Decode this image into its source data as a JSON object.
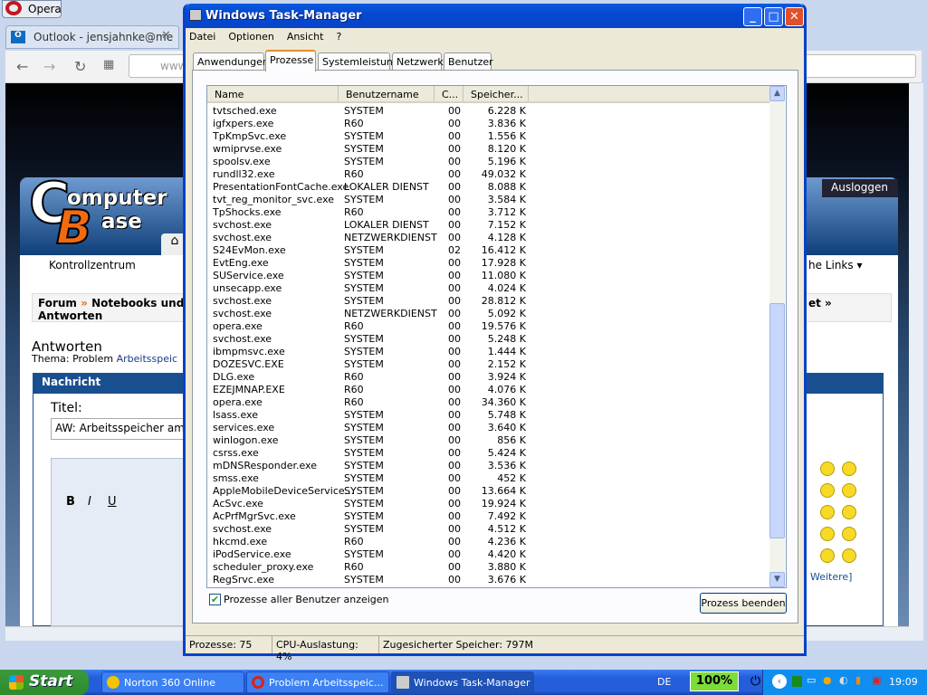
{
  "browser": {
    "app_label": "Opera",
    "tab_title": "Outlook - jensjahnke@me",
    "address": "www",
    "site": {
      "logo_text": "ComputerBase",
      "logo_c": "C",
      "logo_line1": "omputer",
      "logo_b": "B",
      "logo_line2": "ase",
      "nav_item": "Kontrollzentrum",
      "breadcrumb_forum": "Forum",
      "breadcrumb_sep": "»",
      "breadcrumb_section": "Notebooks und",
      "breadcrumb_line2": "Antworten",
      "page_heading": "Antworten",
      "thema_label": "Thema: Problem",
      "thema_link": "Arbeitsspeic",
      "nachricht_header": "Nachricht",
      "titel_label": "Titel:",
      "titel_value": "AW: Arbeitsspeicher am",
      "logout": "Ausloggen",
      "links_menu": "he Links ▾",
      "breadcrumb_right": "et »",
      "weitere": "Weitere]"
    }
  },
  "taskmanager": {
    "title": "Windows Task-Manager",
    "menu": [
      "Datei",
      "Optionen",
      "Ansicht",
      "?"
    ],
    "tabs": [
      "Anwendungen",
      "Prozesse",
      "Systemleistung",
      "Netzwerk",
      "Benutzer"
    ],
    "active_tab": "Prozesse",
    "columns": [
      "Name",
      "Benutzername",
      "C...",
      "Speicher..."
    ],
    "processes": [
      [
        "tvtsched.exe",
        "SYSTEM",
        "00",
        "6.228 K"
      ],
      [
        "igfxpers.exe",
        "R60",
        "00",
        "3.836 K"
      ],
      [
        "TpKmpSvc.exe",
        "SYSTEM",
        "00",
        "1.556 K"
      ],
      [
        "wmiprvse.exe",
        "SYSTEM",
        "00",
        "8.120 K"
      ],
      [
        "spoolsv.exe",
        "SYSTEM",
        "00",
        "5.196 K"
      ],
      [
        "rundll32.exe",
        "R60",
        "00",
        "49.032 K"
      ],
      [
        "PresentationFontCache.exe",
        "LOKALER DIENST",
        "00",
        "8.088 K"
      ],
      [
        "tvt_reg_monitor_svc.exe",
        "SYSTEM",
        "00",
        "3.584 K"
      ],
      [
        "TpShocks.exe",
        "R60",
        "00",
        "3.712 K"
      ],
      [
        "svchost.exe",
        "LOKALER DIENST",
        "00",
        "7.152 K"
      ],
      [
        "svchost.exe",
        "NETZWERKDIENST",
        "00",
        "4.128 K"
      ],
      [
        "S24EvMon.exe",
        "SYSTEM",
        "02",
        "16.412 K"
      ],
      [
        "EvtEng.exe",
        "SYSTEM",
        "00",
        "17.928 K"
      ],
      [
        "SUService.exe",
        "SYSTEM",
        "00",
        "11.080 K"
      ],
      [
        "unsecapp.exe",
        "SYSTEM",
        "00",
        "4.024 K"
      ],
      [
        "svchost.exe",
        "SYSTEM",
        "00",
        "28.812 K"
      ],
      [
        "svchost.exe",
        "NETZWERKDIENST",
        "00",
        "5.092 K"
      ],
      [
        "opera.exe",
        "R60",
        "00",
        "19.576 K"
      ],
      [
        "svchost.exe",
        "SYSTEM",
        "00",
        "5.248 K"
      ],
      [
        "ibmpmsvc.exe",
        "SYSTEM",
        "00",
        "1.444 K"
      ],
      [
        "DOZESVC.EXE",
        "SYSTEM",
        "00",
        "2.152 K"
      ],
      [
        "DLG.exe",
        "R60",
        "00",
        "3.924 K"
      ],
      [
        "EZEJMNAP.EXE",
        "R60",
        "00",
        "4.076 K"
      ],
      [
        "opera.exe",
        "R60",
        "00",
        "34.360 K"
      ],
      [
        "lsass.exe",
        "SYSTEM",
        "00",
        "5.748 K"
      ],
      [
        "services.exe",
        "SYSTEM",
        "00",
        "3.640 K"
      ],
      [
        "winlogon.exe",
        "SYSTEM",
        "00",
        "856 K"
      ],
      [
        "csrss.exe",
        "SYSTEM",
        "00",
        "5.424 K"
      ],
      [
        "mDNSResponder.exe",
        "SYSTEM",
        "00",
        "3.536 K"
      ],
      [
        "smss.exe",
        "SYSTEM",
        "00",
        "452 K"
      ],
      [
        "AppleMobileDeviceService...",
        "SYSTEM",
        "00",
        "13.664 K"
      ],
      [
        "AcSvc.exe",
        "SYSTEM",
        "00",
        "19.924 K"
      ],
      [
        "AcPrfMgrSvc.exe",
        "SYSTEM",
        "00",
        "7.492 K"
      ],
      [
        "svchost.exe",
        "SYSTEM",
        "00",
        "4.512 K"
      ],
      [
        "hkcmd.exe",
        "R60",
        "00",
        "4.236 K"
      ],
      [
        "iPodService.exe",
        "SYSTEM",
        "00",
        "4.420 K"
      ],
      [
        "scheduler_proxy.exe",
        "R60",
        "00",
        "3.880 K"
      ],
      [
        "RegSrvc.exe",
        "SYSTEM",
        "00",
        "3.676 K"
      ]
    ],
    "show_all_users_label": "Prozesse aller Benutzer anzeigen",
    "show_all_users_checked": true,
    "end_process_label": "Prozess beenden",
    "status": {
      "processes": "Prozesse: 75",
      "cpu": "CPU-Auslastung: 4%",
      "commit": "Zugesicherter Speicher: 797M"
    }
  },
  "taskbar": {
    "start": "Start",
    "items": [
      "Norton 360 Online",
      "Problem Arbeitsspeic...",
      "Windows Task-Manager"
    ],
    "active_item": "Windows Task-Manager",
    "language": "DE",
    "battery": "100%",
    "clock": "19:09"
  },
  "colors": {
    "xp_blue": "#0842c8",
    "taskbar": "#245edb",
    "start_green": "#3c9a3c",
    "cb_orange": "#f26a10"
  }
}
